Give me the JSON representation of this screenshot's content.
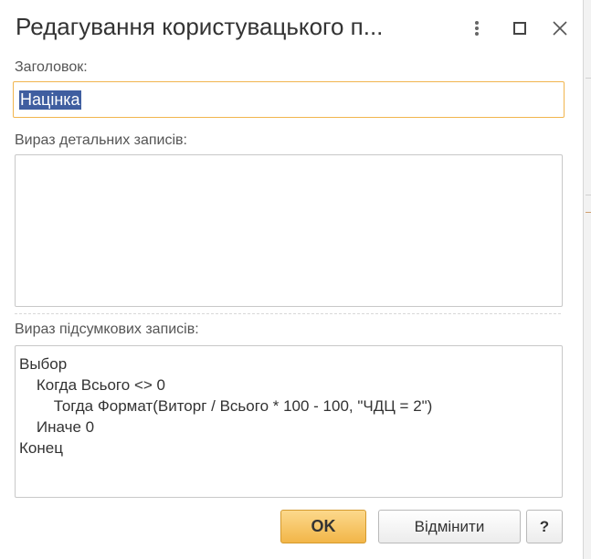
{
  "window": {
    "title": "Редагування користувацького п...",
    "more_icon": "more-vertical-icon",
    "maximize_icon": "maximize-icon",
    "close_icon": "close-icon"
  },
  "form": {
    "title_label": "Заголовок:",
    "title_value": "Націнка",
    "detail_label": "Вираз детальних записів:",
    "detail_value": "",
    "summary_label": "Вираз підсумкових записів:",
    "summary_lines": [
      "Выбор",
      "    Когда Всього <> 0",
      "        Тогда Формат(Виторг / Всього * 100 - 100, \"ЧДЦ = 2\")",
      "    Иначе 0",
      "Конец"
    ]
  },
  "buttons": {
    "ok": "OK",
    "cancel": "Відмінити",
    "help": "?"
  },
  "colors": {
    "accent_border": "#f1b54e",
    "ok_button": "#f2b648",
    "selection": "#3f5ea0"
  }
}
